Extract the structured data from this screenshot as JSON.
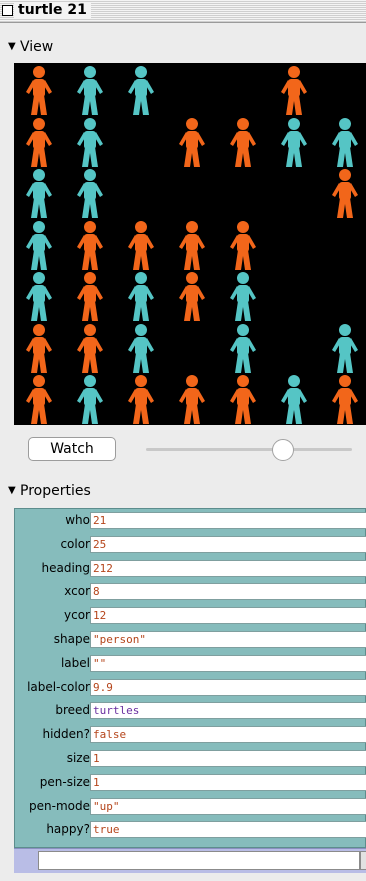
{
  "window": {
    "title": "turtle 21"
  },
  "view_section": {
    "label": "View"
  },
  "turtles": {
    "colors": {
      "orange": "#f2661a",
      "cyan": "#55c5c5"
    },
    "grid": [
      [
        "orange",
        "cyan",
        "cyan",
        null,
        null,
        "orange",
        null,
        null
      ],
      [
        "orange",
        "cyan",
        null,
        "orange",
        "orange",
        "cyan",
        "cyan",
        null
      ],
      [
        "cyan",
        "cyan",
        null,
        null,
        null,
        null,
        "orange",
        null
      ],
      [
        "cyan",
        "orange",
        "orange",
        "orange",
        "orange",
        null,
        null,
        null
      ],
      [
        "cyan",
        "orange",
        "cyan",
        "orange",
        "cyan",
        null,
        null,
        null
      ],
      [
        "orange",
        "orange",
        "cyan",
        null,
        "cyan",
        null,
        "cyan",
        null
      ],
      [
        "orange",
        "cyan",
        "orange",
        "orange",
        "orange",
        "cyan",
        "orange",
        null
      ]
    ]
  },
  "controls": {
    "watch_label": "Watch",
    "slider_level": 0.66
  },
  "properties_section": {
    "label": "Properties"
  },
  "properties": [
    {
      "name": "who",
      "value": "21",
      "color": "#b5451b"
    },
    {
      "name": "color",
      "value": "25",
      "color": "#b5451b"
    },
    {
      "name": "heading",
      "value": "212",
      "color": "#b5451b"
    },
    {
      "name": "xcor",
      "value": "8",
      "color": "#b5451b"
    },
    {
      "name": "ycor",
      "value": "12",
      "color": "#b5451b"
    },
    {
      "name": "shape",
      "value": "\"person\"",
      "color": "#b5451b"
    },
    {
      "name": "label",
      "value": "\"\"",
      "color": "#b5451b"
    },
    {
      "name": "label-color",
      "value": "9.9",
      "color": "#b5451b"
    },
    {
      "name": "breed",
      "value": "turtles",
      "color": "#6a2fa0"
    },
    {
      "name": "hidden?",
      "value": "false",
      "color": "#b5451b"
    },
    {
      "name": "size",
      "value": "1",
      "color": "#b5451b"
    },
    {
      "name": "pen-size",
      "value": "1",
      "color": "#b5451b"
    },
    {
      "name": "pen-mode",
      "value": "\"up\"",
      "color": "#b5451b"
    },
    {
      "name": "happy?",
      "value": "true",
      "color": "#b5451b"
    }
  ],
  "command": {
    "value": ""
  }
}
